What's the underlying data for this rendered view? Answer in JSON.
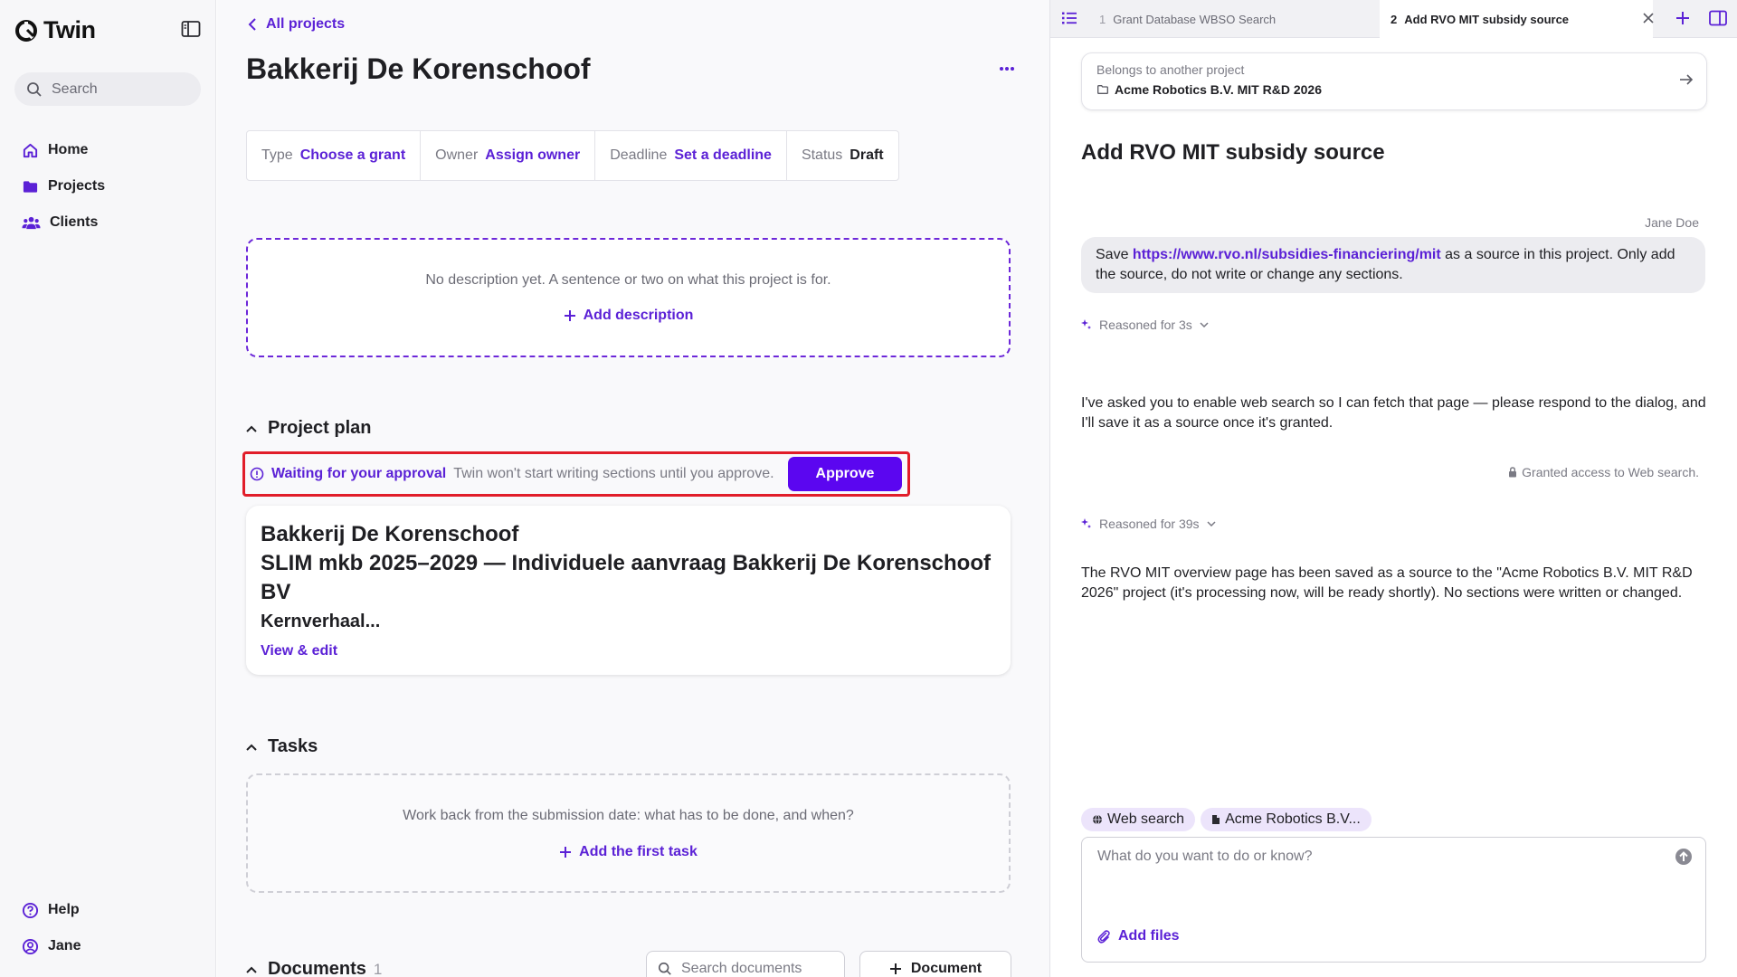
{
  "app": {
    "name": "Twin"
  },
  "sidebar": {
    "search_placeholder": "Search",
    "nav": [
      {
        "label": "Home",
        "icon": "home-icon"
      },
      {
        "label": "Projects",
        "icon": "folder-icon"
      },
      {
        "label": "Clients",
        "icon": "users-icon"
      }
    ],
    "bottom": [
      {
        "label": "Help",
        "icon": "help-icon"
      },
      {
        "label": "Jane",
        "icon": "user-icon"
      }
    ]
  },
  "main": {
    "back_label": "All projects",
    "title": "Bakkerij De Korenschoof",
    "meta": {
      "type_label": "Type",
      "type_value": "Choose a grant",
      "owner_label": "Owner",
      "owner_value": "Assign owner",
      "deadline_label": "Deadline",
      "deadline_value": "Set a deadline",
      "status_label": "Status",
      "status_value": "Draft"
    },
    "description": {
      "empty_text": "No description yet. A sentence or two on what this project is for.",
      "add_label": "Add description"
    },
    "project_plan": {
      "heading": "Project plan",
      "approval_title": "Waiting for your approval",
      "approval_sub": "Twin won't start writing sections until you approve.",
      "approve_label": "Approve",
      "card_line1": "Bakkerij De Korenschoof",
      "card_line2": "SLIM mkb 2025–2029 — Individuele aanvraag Bakkerij De Korenschoof BV",
      "card_line3": "Kernverhaal...",
      "card_link": "View & edit"
    },
    "tasks": {
      "heading": "Tasks",
      "empty_text": "Work back from the submission date: what has to be done, and when?",
      "add_label": "Add the first task"
    },
    "documents": {
      "heading": "Documents",
      "count": "1",
      "search_placeholder": "Search documents",
      "add_label": "Document"
    }
  },
  "panel": {
    "tabs": [
      {
        "num": "1",
        "label": "Grant Database WBSO Search"
      },
      {
        "num": "2",
        "label": "Add RVO MIT subsidy source"
      }
    ],
    "project_card": {
      "label": "Belongs to another project",
      "value": "Acme Robotics B.V. MIT R&D 2026"
    },
    "title": "Add RVO MIT subsidy source",
    "author": "Jane Doe",
    "user_message": {
      "prefix": "Save ",
      "link": "https://www.rvo.nl/subsidies-financiering/mit",
      "suffix": " as a source in this project. Only add the source, do not write or change any sections."
    },
    "reasoned1": "Reasoned for 3s",
    "bot_message1": "I've asked you to enable web search so I can fetch that page — please respond to the dialog, and I'll save it as a source once it's granted.",
    "granted": "Granted access to Web search.",
    "reasoned2": "Reasoned for 39s",
    "bot_message2": "The RVO MIT overview page has been saved as a source to the \"Acme Robotics B.V. MIT R&D 2026\" project (it's processing now, will be ready shortly). No sections were written or changed.",
    "chips": [
      {
        "label": "Web search",
        "icon": "globe-icon"
      },
      {
        "label": "Acme Robotics B.V...",
        "icon": "document-icon"
      }
    ],
    "composer_placeholder": "What do you want to do or know?",
    "add_files_label": "Add files"
  },
  "colors": {
    "accent": "#5b21d6",
    "button": "#5b06f0",
    "highlight_border": "#e11d2a",
    "chip_bg": "#ece4fb"
  }
}
